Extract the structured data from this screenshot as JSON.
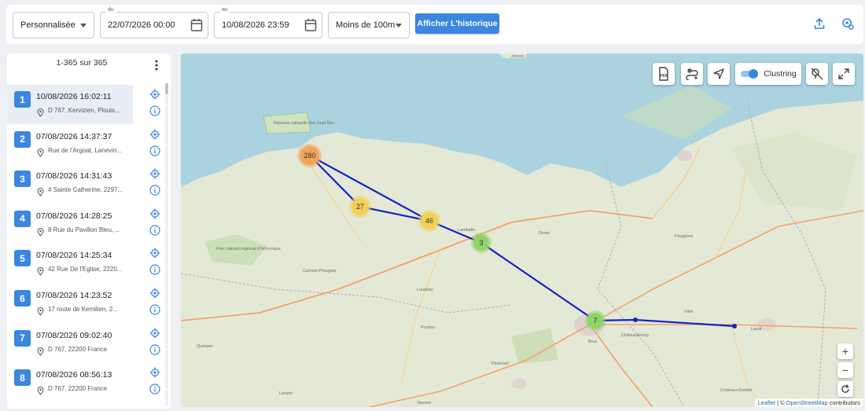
{
  "toolbar": {
    "period_select": "Personnalisée",
    "from_label": "du",
    "from_value": "22/07/2026 00:00",
    "to_label": "au",
    "to_value": "10/08/2026 23:59",
    "distance_select": "Moins de 100m",
    "history_button": "Afficher L'historique",
    "export_icon": "upload-icon",
    "locate_icon": "location-settings-icon"
  },
  "sidebar": {
    "pager": "1-365 sur 365",
    "items": [
      {
        "num": "1",
        "datetime": "10/08/2026 16:02:11",
        "address": "D 767, Kervizien, Plouis..."
      },
      {
        "num": "2",
        "datetime": "07/08/2026 14:37:37",
        "address": "Rue de l'Argoat, Lanevin..."
      },
      {
        "num": "3",
        "datetime": "07/08/2026 14:31:43",
        "address": "4 Sainte Catherine, 2297..."
      },
      {
        "num": "4",
        "datetime": "07/08/2026 14:28:25",
        "address": "8 Rue du Pavillon Bleu, ..."
      },
      {
        "num": "5",
        "datetime": "07/08/2026 14:25:34",
        "address": "42 Rue De l'Eglise, 2220..."
      },
      {
        "num": "6",
        "datetime": "07/08/2026 14:23:52",
        "address": "17 route de Kemilien, 2..."
      },
      {
        "num": "7",
        "datetime": "07/08/2026 09:02:40",
        "address": "D 767, 22200 France"
      },
      {
        "num": "8",
        "datetime": "07/08/2026 08:56:13",
        "address": "D 767, 22200 France"
      }
    ]
  },
  "map": {
    "clustering_label": "Clustring",
    "clusters": [
      {
        "label": "280",
        "color": "#f0a35a"
      },
      {
        "label": "27",
        "color": "#f2cf5a"
      },
      {
        "label": "46",
        "color": "#f2cf5a"
      },
      {
        "label": "3",
        "color": "#8fd36a"
      },
      {
        "label": "7",
        "color": "#8fd36a"
      }
    ],
    "route_color": "#1522c8",
    "zoom_in": "+",
    "zoom_out": "−",
    "attribution_leaflet": "Leaflet",
    "attribution_sep": " | © ",
    "attribution_osm": "OpenStreetMap",
    "attribution_tail": " contributors",
    "places": [
      "Jersey",
      "Lamballe",
      "Dinan",
      "Fougères",
      "Carhaix-Plouguer",
      "Loudéac",
      "Pontivy",
      "Châteaubourg",
      "Bruz",
      "Ploërmel",
      "Laval",
      "Vitré",
      "Château-Gontier",
      "Quimper",
      "Lorient",
      "Vannes",
      "Parc naturel régional d'Armorique",
      "Réserve naturelle des Sept Îles"
    ]
  }
}
